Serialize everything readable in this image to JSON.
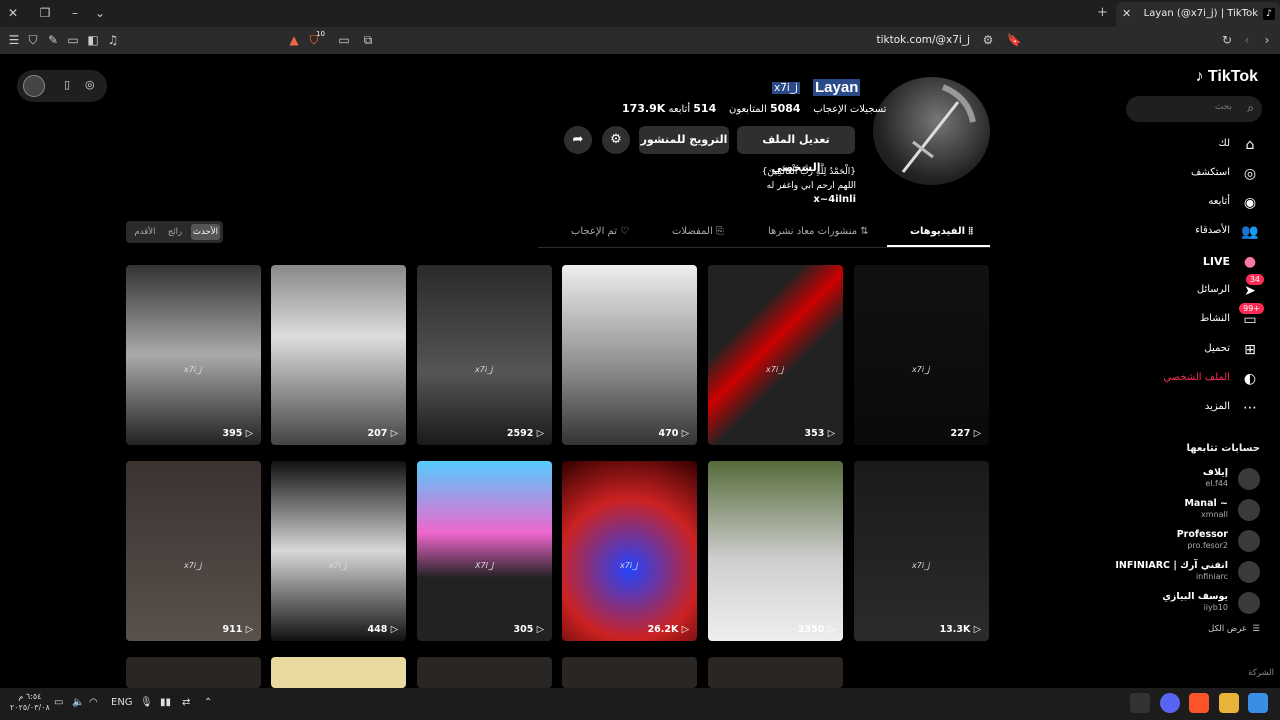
{
  "browser": {
    "tab_title": "Layan (@x7i_j) | TikTok",
    "url": "tiktok.com/@x7i_j",
    "shield_count": "10"
  },
  "sidebar": {
    "logo": "TikTok",
    "search_placeholder": "بحث",
    "nav": [
      {
        "label": "لك",
        "icon": "home-icon"
      },
      {
        "label": "استكشف",
        "icon": "compass-icon"
      },
      {
        "label": "أتابعه",
        "icon": "following-icon"
      },
      {
        "label": "الأصدقاء",
        "icon": "friends-icon"
      },
      {
        "label": "LIVE",
        "icon": "live-icon"
      },
      {
        "label": "الرسائل",
        "icon": "messages-icon",
        "badge": "34"
      },
      {
        "label": "النشاط",
        "icon": "activity-icon",
        "badge": "99+"
      },
      {
        "label": "تحميل",
        "icon": "upload-icon"
      },
      {
        "label": "الملف الشخصي",
        "icon": "profile-icon"
      },
      {
        "label": "المزيد",
        "icon": "more-icon"
      }
    ],
    "following_heading": "حسابات تتابعها",
    "following": [
      {
        "name": "إيلاف",
        "handle": "el.f44"
      },
      {
        "name": "Manal ~",
        "handle": "xmnall"
      },
      {
        "name": "Professor",
        "handle": "pro.fesor2"
      },
      {
        "name": "INFINIARC | انفني آرك",
        "handle": "infiniarc"
      },
      {
        "name": "يوسف البيازي",
        "handle": "iiyb10"
      }
    ],
    "see_all": "عرض الكل",
    "company": "الشركة"
  },
  "profile": {
    "username": "Layan",
    "nickname": "x7i_j",
    "following_label": "أتابعه",
    "following_count": "514",
    "followers_label": "المتابعون",
    "followers_count": "5084",
    "likes_label": "تسجيلات الإعجاب",
    "likes_count": "173.9K",
    "edit_button": "تعديل الملف الشخصي",
    "promote_button": "الترويج للمنشور",
    "bio_line1": "{الْحَمْدُ لِلَّهِ رَبِّ الْعَالَمِينَ}",
    "bio_line2": "اللهم ارحم ابي واغفر له",
    "bio_line3": "x~4ilnli"
  },
  "tabs": [
    {
      "label": "الفيديوهات",
      "active": true
    },
    {
      "label": "منشورات معاد نشرها",
      "active": false
    },
    {
      "label": "المفضلات",
      "active": false
    },
    {
      "label": "تم الإعجاب",
      "active": false
    }
  ],
  "sort": [
    {
      "label": "الأحدث",
      "active": true
    },
    {
      "label": "رائج",
      "active": false
    },
    {
      "label": "الأقدم",
      "active": false
    }
  ],
  "videos": [
    {
      "views": "227",
      "watermark": "x7i_j"
    },
    {
      "views": "353",
      "watermark": "x7i_j"
    },
    {
      "views": "470",
      "watermark": ""
    },
    {
      "views": "2592",
      "watermark": "x7i_j"
    },
    {
      "views": "207",
      "watermark": ""
    },
    {
      "views": "395",
      "watermark": "x7i_j"
    },
    {
      "views": "13.3K",
      "watermark": "x7i_j"
    },
    {
      "views": "2350",
      "watermark": ""
    },
    {
      "views": "26.2K",
      "watermark": "x7i_j"
    },
    {
      "views": "305",
      "watermark": "X7I_J"
    },
    {
      "views": "448",
      "watermark": "x7i_j"
    },
    {
      "views": "911",
      "watermark": "x7i_j"
    }
  ],
  "taskbar": {
    "lang": "ENG",
    "time": "٦:٥٤ م",
    "date": "٢٠٢٥/٠٣/٠٨"
  }
}
